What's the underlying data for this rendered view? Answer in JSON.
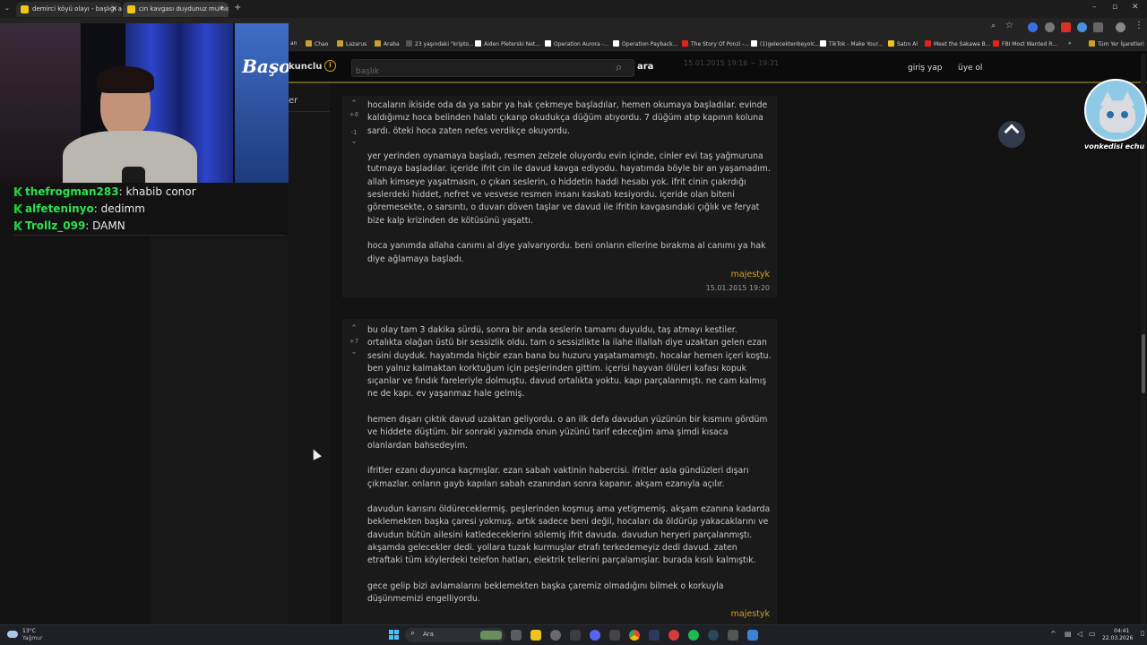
{
  "tabs": [
    {
      "title": "demirci köyü olayı - başlığı açan..."
    },
    {
      "title": "cin kavgası duydunuz mu hiç - ..."
    }
  ],
  "bookmarks": [
    {
      "label": "an",
      "color": "#444"
    },
    {
      "label": "Chao",
      "color": "#c9a227"
    },
    {
      "label": "Lazarus",
      "color": "#c9a227"
    },
    {
      "label": "Araba",
      "color": "#c9a227"
    },
    {
      "label": "23 yaşındaki \"kripto...",
      "color": "#555"
    },
    {
      "label": "Aiden Pleterski Net...",
      "color": "#fff"
    },
    {
      "label": "Operation Aurora -...",
      "color": "#fff"
    },
    {
      "label": "Operation Payback...",
      "color": "#fff"
    },
    {
      "label": "The Story Of Ponzi -...",
      "color": "#e62117"
    },
    {
      "label": "(1)gelecektenbeyolc...",
      "color": "#fff"
    },
    {
      "label": "TikTok - Make Your...",
      "color": "#fff"
    },
    {
      "label": "Satın Al",
      "color": "#f0c419"
    },
    {
      "label": "Meet the Sakawa B...",
      "color": "#e62117"
    },
    {
      "label": "FBI Most Wanted R...",
      "color": "#e62117"
    },
    {
      "label": "Tüm Yer İşaretleri",
      "color": "#c9a227"
    }
  ],
  "site": {
    "nav_fragment": "kunclu",
    "search_placeholder": "başlık",
    "search_button": "ara",
    "login": "giriş yap",
    "register": "üye ol",
    "faded_date": "15.01.2015 19:16 ~ 19:21",
    "sidebar_fragment": "er"
  },
  "entries": [
    {
      "up_count": "+6",
      "down_count": "-1",
      "paragraphs": [
        "hocaların ikiside oda da ya sabır ya hak çekmeye başladılar, hemen okumaya başladılar. evinde kaldığımız hoca belinden halatı çıkarıp okudukça düğüm atıyordu. 7 düğüm atıp kapının koluna sardı. öteki hoca zaten nefes verdikçe okuyordu.",
        "yer yerinden oynamaya başladı, resmen zelzele oluyordu evin içinde, cinler evi taş yağmuruna tutmaya başladılar. içeride ifrit cin ile davud kavga ediyodu. hayatımda böyle bir an yaşamadım. allah kimseye yaşatmasın, o çıkan seslerin, o hiddetin haddi hesabı yok. ifrit cinin çıakrdığı seslerdeki hiddet, nefret ve vesvese resmen insanı kaskatı kesiyordu. içeride olan biteni göremesekte, o sarsıntı, o duvarı döven taşlar ve davud ile ifritin kavgasındaki çığlık ve feryat bize kalp krizinden de kötüsünü yaşattı.",
        "hoca yanımda allaha canımı al diye yalvarıyordu. beni onların ellerine bırakma al canımı ya hak diye ağlamaya başladı."
      ],
      "author": "majestyk",
      "date": "15.01.2015 19:20"
    },
    {
      "up_count": "+7",
      "down_count": "",
      "paragraphs": [
        "bu olay tam 3 dakika sürdü, sonra bir anda seslerin tamamı duyuldu, taş atmayı kestiler. ortalıkta olağan üstü bir sessizlik oldu. tam o sessizlikte la ilahe illallah diye uzaktan gelen ezan sesini duyduk. hayatımda hiçbir ezan bana bu huzuru yaşatamamıştı. hocalar hemen içeri koştu. ben yalnız kalmaktan korktuğum için peşlerinden gittim. içerisi hayvan ölüleri kafası kopuk sıçanlar ve fındık fareleriyle dolmuştu. davud ortalıkta yoktu. kapı parçalanmıştı. ne cam kalmış ne de kapı. ev yaşanmaz hale gelmiş.",
        "hemen dışarı çıktık davud uzaktan geliyordu. o an ilk defa davudun yüzünün bir kısmını gördüm ve hiddete düştüm. bir sonraki yazımda onun yüzünü tarif edeceğim ama şimdi kısaca olanlardan bahsedeyim.",
        "ifritler ezanı duyunca kaçmışlar. ezan sabah vaktinin habercisi. ifritler asla gündüzleri dışarı çıkmazlar. onların gayb kapıları sabah ezanından sonra kapanır. akşam ezanıyla açılır.",
        "davudun karısını öldüreceklermiş. peşlerinden koşmuş ama yetişmemiş. akşam ezanına kadarda beklemekten başka çaresi yokmuş. artık sadece beni değil, hocaları da öldürüp yakacaklarını ve davudun bütün ailesini katledeceklerini sölemiş ifrit davuda. davudun heryeri parçalanmıştı. akşamda gelecekler dedi. yollara tuzak kurmuşlar etrafı terkedemeyiz dedi davud. zaten etraftaki tüm köylerdeki telefon hatları, elektrik tellerini parçalamışlar. burada kısılı kalmıştık.",
        "gece gelip bizi avlamalarını beklemekten başka çaremiz olmadığını bilmek o korkuyla düşünmemizi engelliyordu."
      ],
      "author": "majestyk",
      "date": ""
    }
  ],
  "stream": {
    "logo_text": "Başo",
    "cat_caption": "vonkedisi echu",
    "chat": [
      {
        "user": "thefrogman283",
        "message": "khabib conor"
      },
      {
        "user": "alfeteninyo",
        "message": "dedimm"
      },
      {
        "user": "Trollz_099",
        "message": "DAMN"
      }
    ]
  },
  "taskbar": {
    "weather_temp": "13°C",
    "weather_desc": "Yağmur",
    "search_label": "Ara",
    "time": "04:41",
    "date": "22.03.2026"
  }
}
